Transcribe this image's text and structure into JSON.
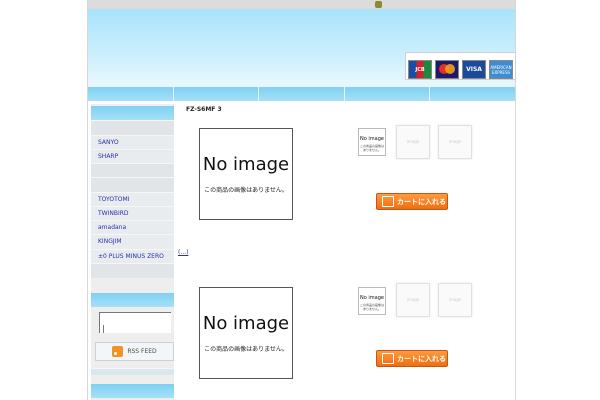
{
  "payment_cards": [
    {
      "name": "jcb",
      "label": "JCB"
    },
    {
      "name": "mastercard",
      "label": ""
    },
    {
      "name": "visa",
      "label": "VISA"
    },
    {
      "name": "amex",
      "label": "AMERICAN EXPRESS"
    }
  ],
  "sidebar": {
    "brands": [
      "SANYO",
      "SHARP",
      "TOYOTOMI",
      "TWINBIRD",
      "amadana",
      "KINGJIM",
      "±0 PLUS MINUS ZERO"
    ],
    "rss_label": "RSS FEED"
  },
  "products": [
    {
      "title": "FZ-S6MF 3",
      "noimage_text": "No image",
      "noimage_caption": "この商品の画像はありません。",
      "thumb_text": "No image",
      "thumb_caption": "この商品の画像はありません。",
      "ghost_text": "image",
      "cart_label": "カートに入れる"
    },
    {
      "title": "",
      "noimage_text": "No image",
      "noimage_caption": "この商品の画像はありません。",
      "thumb_text": "No image",
      "thumb_caption": "この商品の画像はありません。",
      "ghost_text": "image",
      "cart_label": "カートに入れる"
    }
  ],
  "more_link": "(...)"
}
